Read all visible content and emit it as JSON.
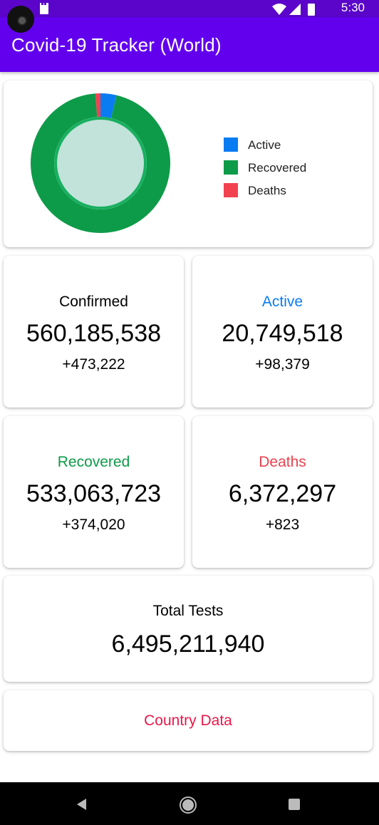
{
  "status_bar": {
    "time": "5:30"
  },
  "app_bar": {
    "title": "Covid-19 Tracker (World)"
  },
  "colors": {
    "primary": "#6200ee",
    "status_bar": "#5a05c9",
    "active": "#0a7cf2",
    "recovered": "#0e9b49",
    "deaths": "#f2424f",
    "country_link": "#e8184a",
    "donut_center": "#c2e3da"
  },
  "chart_data": {
    "type": "pie",
    "title": "",
    "labels": [
      "Active",
      "Recovered",
      "Deaths"
    ],
    "values": [
      20749518,
      533063723,
      6372297
    ],
    "legend_position": "right"
  },
  "legend": [
    {
      "label": "Active"
    },
    {
      "label": "Recovered"
    },
    {
      "label": "Deaths"
    }
  ],
  "stats": {
    "confirmed": {
      "label": "Confirmed",
      "value": "560,185,538",
      "delta": "+473,222"
    },
    "active": {
      "label": "Active",
      "value": "20,749,518",
      "delta": "+98,379"
    },
    "recovered": {
      "label": "Recovered",
      "value": "533,063,723",
      "delta": "+374,020"
    },
    "deaths": {
      "label": "Deaths",
      "value": "6,372,297",
      "delta": "+823"
    }
  },
  "tests": {
    "label": "Total Tests",
    "value": "6,495,211,940"
  },
  "country": {
    "label": "Country Data"
  },
  "nav_icons": [
    "back-icon",
    "home-icon",
    "recents-icon"
  ]
}
